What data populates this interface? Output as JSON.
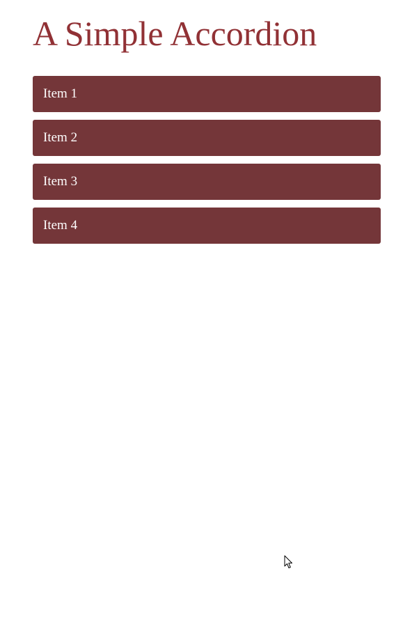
{
  "title": "A Simple Accordion",
  "accordion": {
    "items": [
      {
        "label": "Item 1"
      },
      {
        "label": "Item 2"
      },
      {
        "label": "Item 3"
      },
      {
        "label": "Item 4"
      }
    ]
  },
  "colors": {
    "title": "#913135",
    "item_background": "#743639",
    "item_text": "#ffffff",
    "page_background": "#ffffff"
  },
  "icons": {
    "cursor": "mouse-pointer-icon"
  }
}
